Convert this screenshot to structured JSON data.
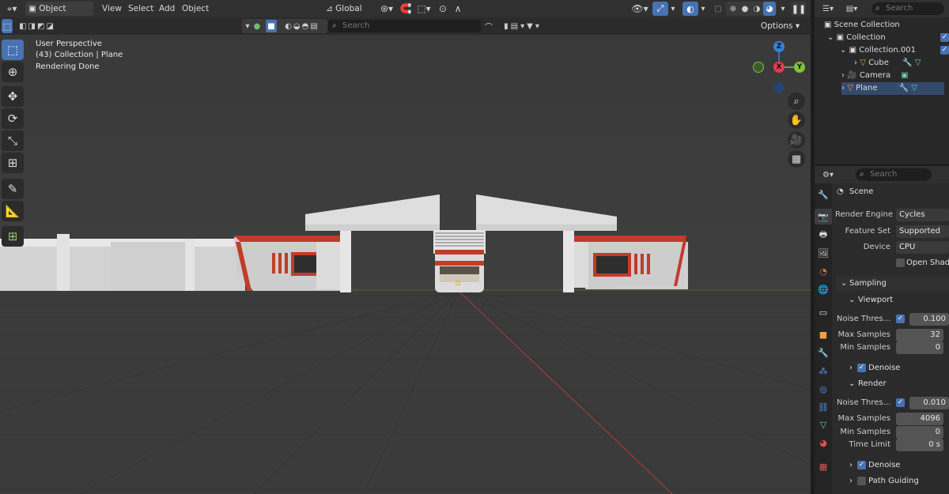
{
  "header": {
    "mode": "Object Mode",
    "menus": [
      "View",
      "Select",
      "Add",
      "Object"
    ],
    "orientation": "Global",
    "options": "Options",
    "search_placeholder": "Search"
  },
  "overlay": {
    "perspective": "User Perspective",
    "collection": "(43) Collection | Plane",
    "status": "Rendering Done"
  },
  "gizmo": {
    "z": "Z",
    "x": "X",
    "y": "Y"
  },
  "outliner": {
    "search_placeholder": "Search",
    "items": [
      {
        "label": "Scene Collection"
      },
      {
        "label": "Collection"
      },
      {
        "label": "Collection.001"
      },
      {
        "label": "Cube"
      },
      {
        "label": "Camera"
      },
      {
        "label": "Plane"
      }
    ]
  },
  "properties": {
    "search_placeholder": "Search",
    "context": "Scene",
    "render_engine_label": "Render Engine",
    "render_engine": "Cycles",
    "feature_set_label": "Feature Set",
    "feature_set": "Supported",
    "device_label": "Device",
    "device": "CPU",
    "open_shading": "Open Shadin",
    "sampling": "Sampling",
    "viewport": {
      "title": "Viewport",
      "noise_label": "Noise Thres...",
      "noise": "0.100",
      "max_label": "Max Samples",
      "max": "32",
      "min_label": "Min Samples",
      "min": "0",
      "denoise": "Denoise"
    },
    "render": {
      "title": "Render",
      "noise_label": "Noise Thres...",
      "noise": "0.010",
      "max_label": "Max Samples",
      "max": "4096",
      "min_label": "Min Samples",
      "min": "0",
      "time_label": "Time Limit",
      "time": "0 s",
      "denoise": "Denoise",
      "path_guiding": "Path Guiding"
    }
  },
  "colors": {
    "accent": "#4772b3",
    "x_axis": "#e23d4a",
    "y_axis": "#7ec33a",
    "z_axis": "#3a80d6"
  }
}
